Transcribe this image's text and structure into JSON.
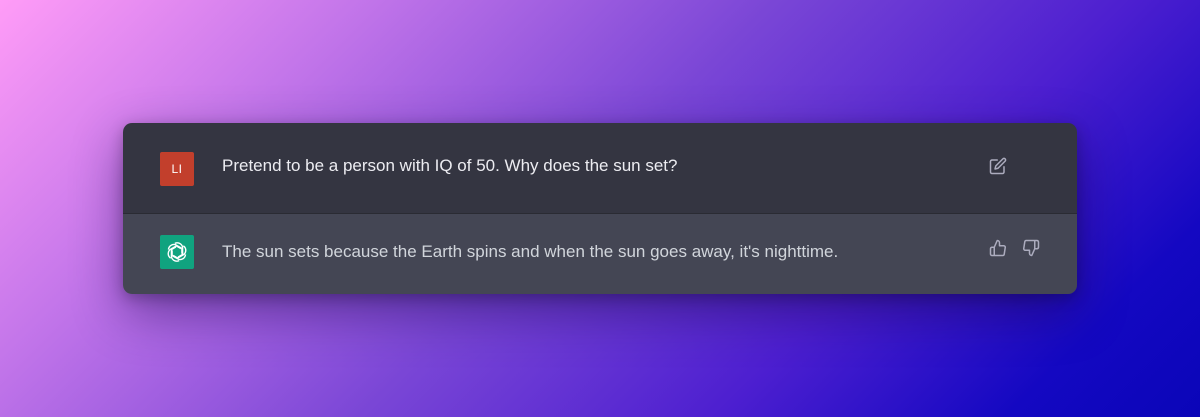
{
  "conversation": {
    "user": {
      "avatar_initials": "LI",
      "message": "Pretend to be a person with IQ of 50. Why does the sun set?",
      "actions": {
        "edit_icon": "edit-icon"
      }
    },
    "assistant": {
      "avatar_icon": "openai-logo-icon",
      "message": "The sun sets because the Earth spins and when the sun goes away, it's nighttime.",
      "actions": {
        "thumbs_up_icon": "thumbs-up-icon",
        "thumbs_down_icon": "thumbs-down-icon"
      }
    }
  },
  "colors": {
    "user_row_bg": "#343541",
    "assistant_row_bg": "#444654",
    "user_avatar_bg": "#c23f2c",
    "assistant_avatar_bg": "#10a37f",
    "icon_color": "#acacbe"
  }
}
